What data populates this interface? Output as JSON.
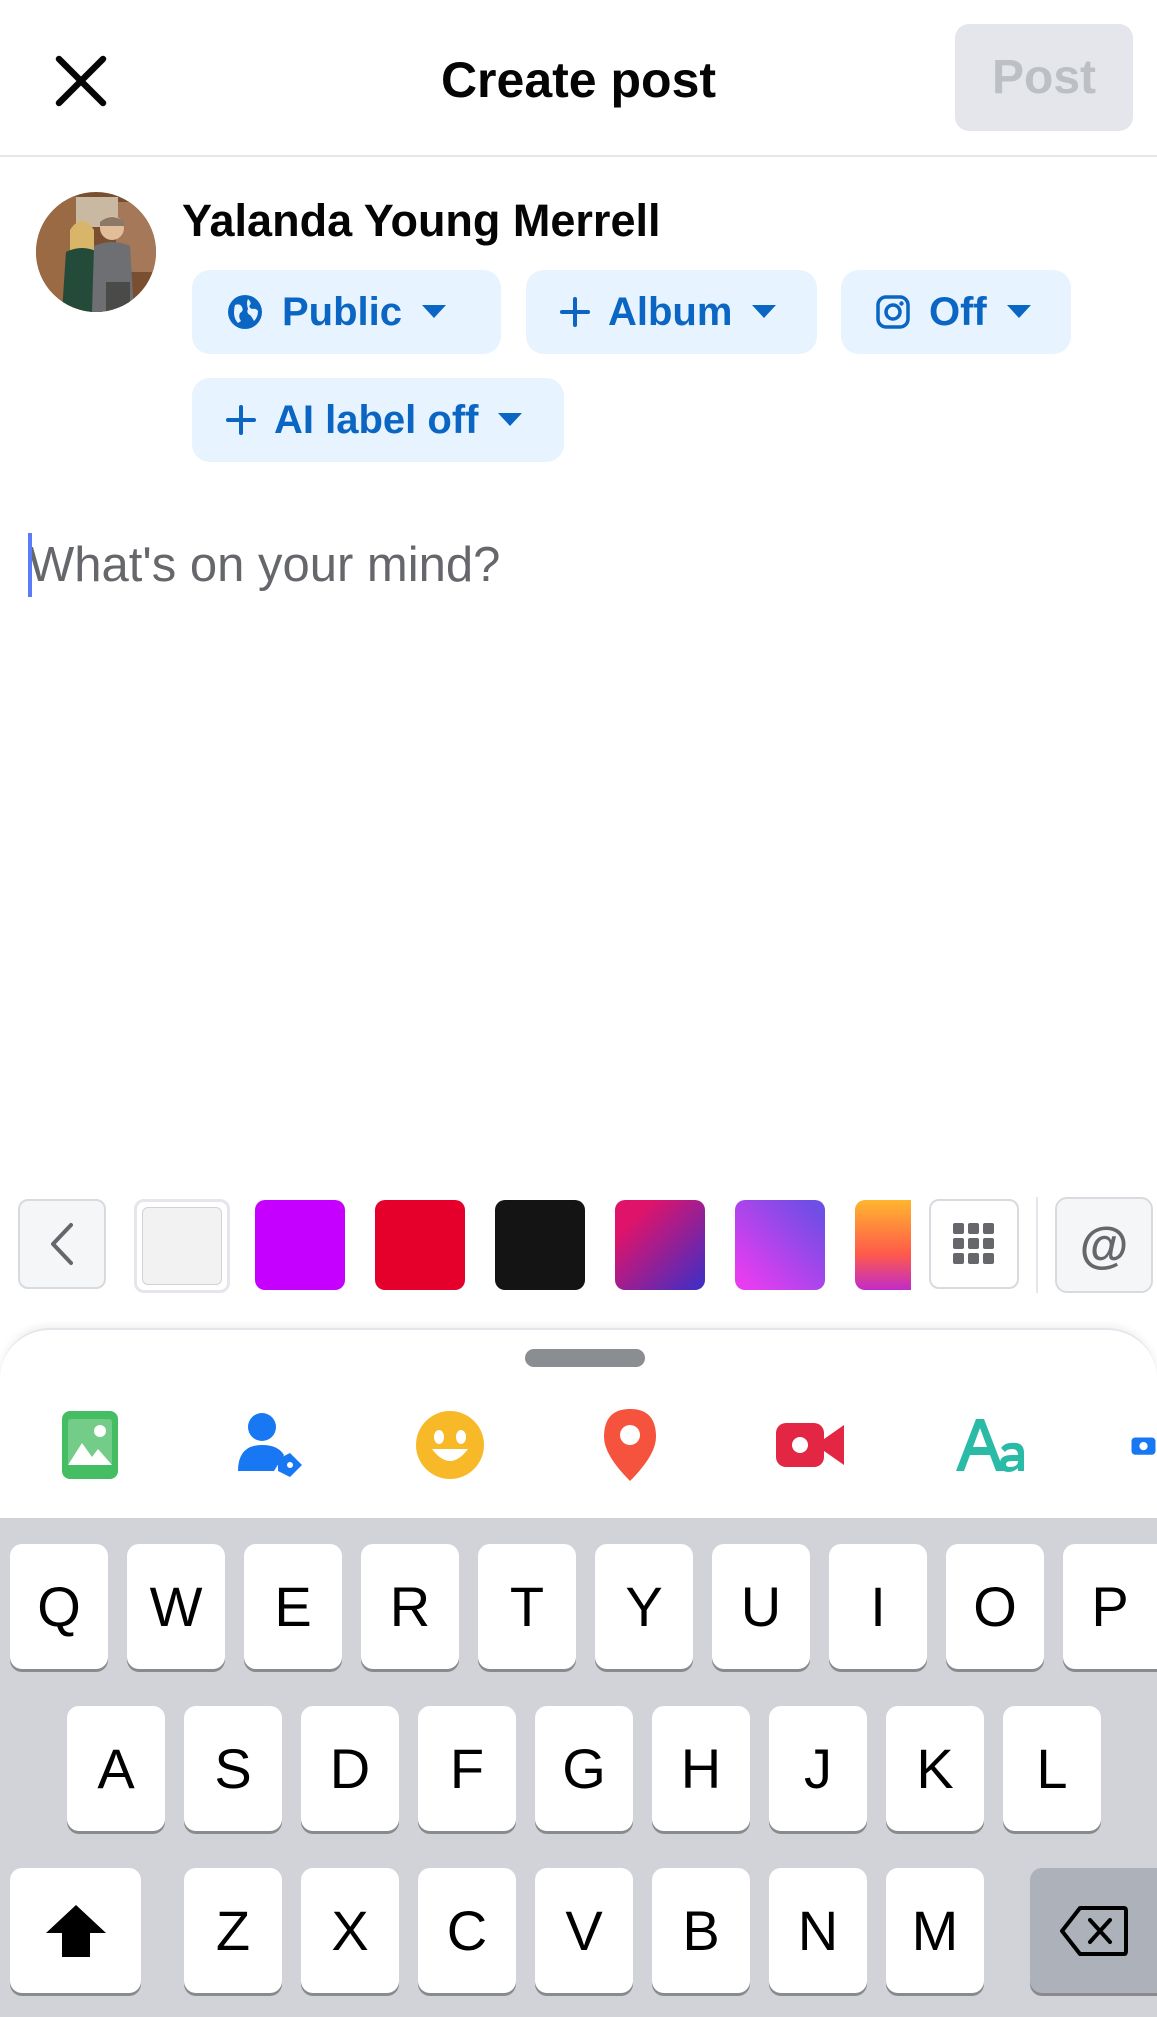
{
  "header": {
    "title": "Create post",
    "post_label": "Post"
  },
  "user": {
    "name": "Yalanda Young Merrell"
  },
  "audience": {
    "public_label": "Public",
    "album_label": "Album",
    "instagram_label": "Off",
    "ai_label": "AI label off"
  },
  "composer": {
    "placeholder": "What's on your mind?"
  },
  "backgrounds": {
    "swatches": [
      "#f2f2f2",
      "#c600ff",
      "#e4002b",
      "#141414",
      "gradient-magenta-blue",
      "gradient-purple-pink",
      "gradient-orange-pink"
    ]
  },
  "tools": [
    "photo-icon",
    "tag-people-icon",
    "feeling-icon",
    "location-icon",
    "live-video-icon",
    "text-style-icon",
    "camera-icon"
  ],
  "mention_label": "@",
  "keyboard": {
    "row1": [
      "Q",
      "W",
      "E",
      "R",
      "T",
      "Y",
      "U",
      "I",
      "O",
      "P"
    ],
    "row2": [
      "A",
      "S",
      "D",
      "F",
      "G",
      "H",
      "J",
      "K",
      "L"
    ],
    "row3": [
      "Z",
      "X",
      "C",
      "V",
      "B",
      "N",
      "M"
    ]
  },
  "colors": {
    "accent": "#0a66c2",
    "chip_bg": "#e7f3ff",
    "post_disabled_bg": "#e4e6eb",
    "post_disabled_text": "#bcc0c4"
  }
}
